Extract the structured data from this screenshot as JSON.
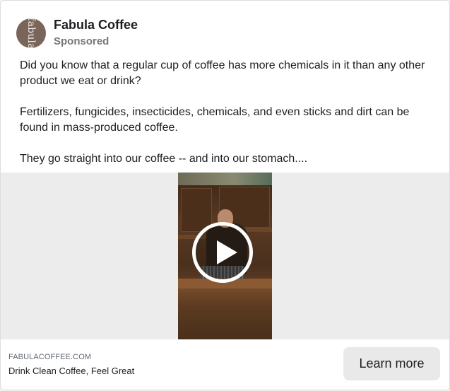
{
  "post": {
    "page_name": "Fabula Coffee",
    "sponsored_label": "Sponsored",
    "avatar_text": "fabula",
    "body": [
      "Did you know that a regular cup of coffee has more chemicals in it than any other product we eat or drink?",
      "Fertilizers, fungicides, insecticides, chemicals, and even sticks and dirt can be found in mass-produced coffee.",
      "They go straight into our coffee -- and into our stomach...."
    ]
  },
  "media": {
    "play_icon": "play-icon"
  },
  "footer": {
    "domain": "FABULACOFFEE.COM",
    "headline": "Drink Clean Coffee, Feel Great",
    "cta_label": "Learn more"
  },
  "colors": {
    "avatar_bg": "#7a655a",
    "cta_bg": "#e9e9e9",
    "media_bg": "#ececec"
  }
}
